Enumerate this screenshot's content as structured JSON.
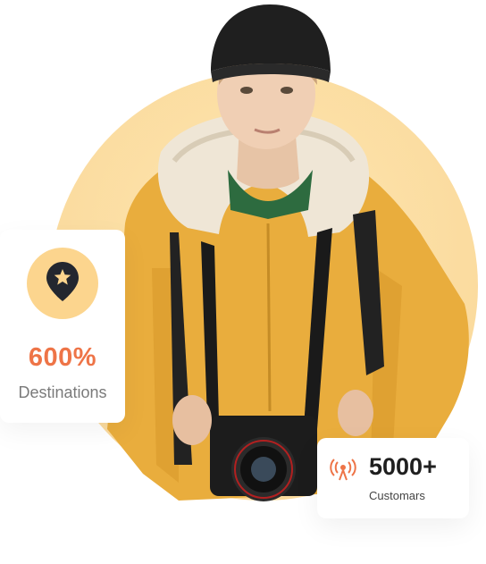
{
  "colors": {
    "circle_background": "#fbdca0",
    "accent_orange": "#ee7447",
    "badge_yellow": "#fcd58e",
    "card_background": "#ffffff",
    "icon_dark": "#23272f"
  },
  "stats": {
    "destinations": {
      "value": "600%",
      "label": "Destinations",
      "icon": "map-pin-star-icon"
    },
    "customers": {
      "value": "5000+",
      "label": "Customars",
      "icon": "broadcast-signal-icon"
    }
  },
  "hero": {
    "image": "traveler-photo"
  }
}
